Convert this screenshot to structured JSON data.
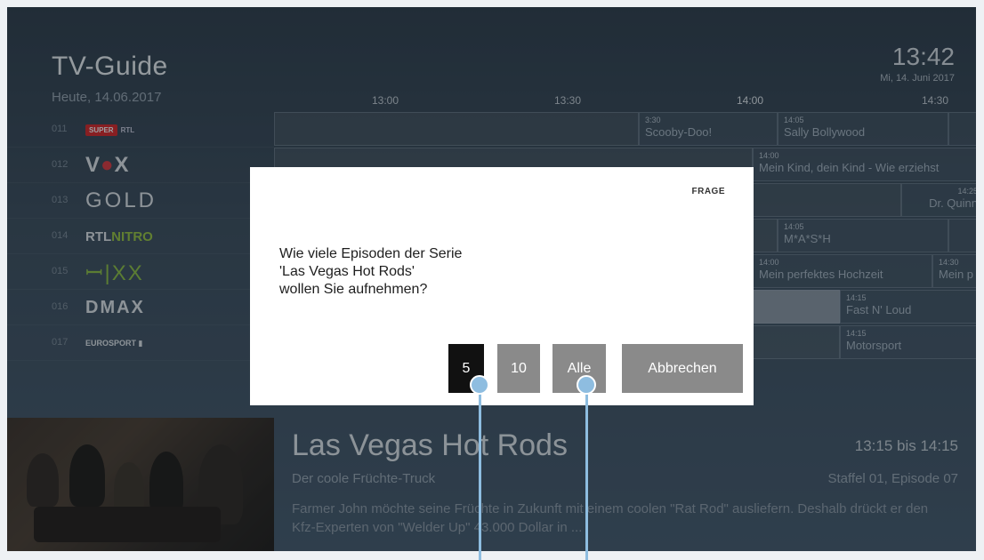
{
  "header": {
    "title": "TV-Guide",
    "date": "Heute, 14.06.2017",
    "clock": "13:42",
    "clock_date": "Mi, 14. Juni 2017"
  },
  "timeline": [
    "13:00",
    "13:30",
    "14:00",
    "14:30"
  ],
  "channels": [
    {
      "number": "011",
      "logo": "SUPER RTL",
      "icon": "super-rtl-logo"
    },
    {
      "number": "012",
      "logo": "VOX",
      "icon": "vox-logo"
    },
    {
      "number": "013",
      "logo": "GOLD",
      "icon": "gold-logo"
    },
    {
      "number": "014",
      "logo": "RTLNITRO",
      "icon": "rtl-nitro-logo"
    },
    {
      "number": "015",
      "logo": "SIXX",
      "icon": "sixx-logo"
    },
    {
      "number": "016",
      "logo": "DMAX",
      "icon": "dmax-logo"
    },
    {
      "number": "017",
      "logo": "EUROSPORT",
      "icon": "eurosport-logo"
    }
  ],
  "grid": {
    "c1": {
      "time": "3:30",
      "name": "Scooby-Doo!"
    },
    "c2": {
      "time": "14:05",
      "name": "Sally Bollywood"
    },
    "c3": {
      "time": "14:00",
      "name": "Mein Kind, dein Kind - Wie erziehst"
    },
    "c4": {
      "time": "14:25",
      "name": "Dr. Quinn"
    },
    "c5": {
      "time": "14:05",
      "name": "M*A*S*H"
    },
    "c6": {
      "time": "14:00",
      "name": "Mein perfektes Hochzeit"
    },
    "c7": {
      "time": "14:30",
      "name": "Mein p"
    },
    "c8": {
      "time": "14:15",
      "name": "Fast N' Loud"
    },
    "c9": {
      "time": "14:15",
      "name": "Motorsport"
    }
  },
  "detail": {
    "title": "Las Vegas Hot Rods",
    "subtitle": "Der coole Früchte-Truck",
    "time_range": "13:15 bis 14:15",
    "episode": "Staffel 01, Episode 07",
    "description": "Farmer John möchte seine Früchte in Zukunft mit einem coolen \"Rat Rod\" ausliefern. Deshalb drückt er den Kfz-Experten von \"Welder Up\" 43.000 Dollar in ..."
  },
  "dialog": {
    "tag": "FRAGE",
    "question_line1": "Wie viele Episoden der Serie",
    "question_line2": "'Las Vegas Hot Rods'",
    "question_line3": "wollen Sie aufnehmen?",
    "btn_5": "5",
    "btn_10": "10",
    "btn_all": "Alle",
    "btn_cancel": "Abbrechen",
    "selected": "5"
  },
  "colors": {
    "dialog_bg": "#ffffff",
    "button_selected": "#111111",
    "button_default": "#8a8a8a",
    "callout": "#8ebde0"
  }
}
